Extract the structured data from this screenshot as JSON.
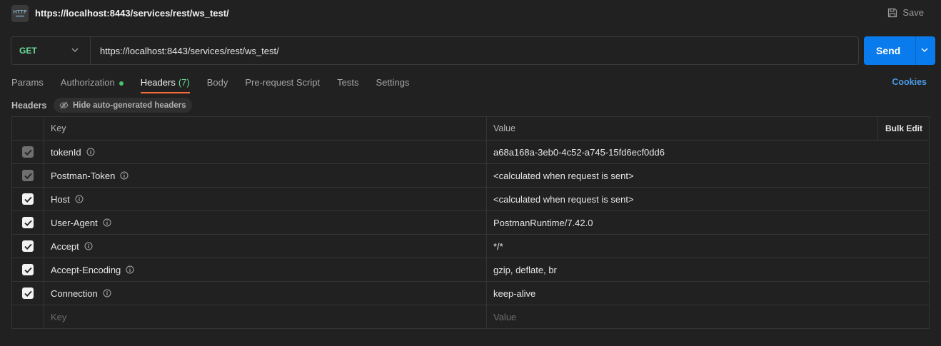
{
  "topbar": {
    "icon_text": "HTTP",
    "title": "https://localhost:8443/services/rest/ws_test/",
    "save_label": "Save"
  },
  "request": {
    "method": "GET",
    "url": "https://localhost:8443/services/rest/ws_test/",
    "send_label": "Send"
  },
  "tabs": [
    {
      "label": "Params"
    },
    {
      "label": "Authorization"
    },
    {
      "label": "Headers",
      "count": "(7)"
    },
    {
      "label": "Body"
    },
    {
      "label": "Pre-request Script"
    },
    {
      "label": "Tests"
    },
    {
      "label": "Settings"
    }
  ],
  "cookies_label": "Cookies",
  "headers_section": {
    "label": "Headers",
    "hide_auto_label": "Hide auto-generated headers"
  },
  "table": {
    "col_key": "Key",
    "col_value": "Value",
    "bulk_edit": "Bulk Edit",
    "rows": [
      {
        "key": "tokenId",
        "value": "a68a168a-3eb0-4c52-a745-15fd6ecf0dd6"
      },
      {
        "key": "Postman-Token",
        "value": "<calculated when request is sent>"
      },
      {
        "key": "Host",
        "value": "<calculated when request is sent>"
      },
      {
        "key": "User-Agent",
        "value": "PostmanRuntime/7.42.0"
      },
      {
        "key": "Accept",
        "value": "*/*"
      },
      {
        "key": "Accept-Encoding",
        "value": "gzip, deflate, br"
      },
      {
        "key": "Connection",
        "value": "keep-alive"
      }
    ],
    "new_key_placeholder": "Key",
    "new_value_placeholder": "Value"
  },
  "colors": {
    "accent": "#097bed",
    "method": "#6bdd9a",
    "active_tab_underline": "#f26b3a",
    "cookies": "#4a9be8"
  }
}
